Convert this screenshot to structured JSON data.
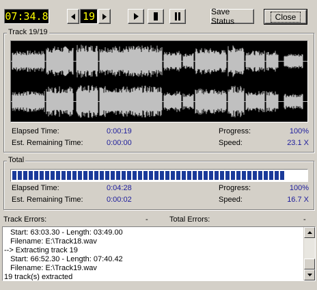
{
  "toolbar": {
    "time_display": "07:34.8",
    "track_number": "19",
    "save_status_label": "Save Status",
    "close_label": "Close"
  },
  "icons": {
    "prev": "prev-track-icon",
    "next": "next-track-icon",
    "play": "play-icon",
    "stop": "stop-icon",
    "pause": "pause-icon"
  },
  "track": {
    "title": "Track 19/19",
    "elapsed_label": "Elapsed Time:",
    "elapsed_value": "0:00:19",
    "remaining_label": "Est. Remaining Time:",
    "remaining_value": "0:00:00",
    "progress_label": "Progress:",
    "progress_value": "100%",
    "speed_label": "Speed:",
    "speed_value": "23.1 X"
  },
  "total": {
    "title": "Total",
    "progress_fraction": 1.0,
    "elapsed_label": "Elapsed Time:",
    "elapsed_value": "0:04:28",
    "remaining_label": "Est. Remaining Time:",
    "remaining_value": "0:00:02",
    "progress_label": "Progress:",
    "progress_value": "100%",
    "speed_label": "Speed:",
    "speed_value": "16.7 X"
  },
  "errors": {
    "track_label": "Track Errors:",
    "track_value": "-",
    "total_label": "Total Errors:",
    "total_value": "-"
  },
  "log_lines": [
    "   Start: 63:03.30 - Length: 03:49.00",
    "   Filename: E:\\Track18.wav",
    "--> Extracting track 19",
    "   Start: 66:52.30 - Length: 07:40.42",
    "   Filename: E:\\Track19.wav",
    "19 track(s) extracted"
  ],
  "colors": {
    "lcd_text": "#ffff00",
    "value_text": "#1c1c9c",
    "progress_block": "#1a3a9a",
    "waveform": "#c0c0c0"
  }
}
